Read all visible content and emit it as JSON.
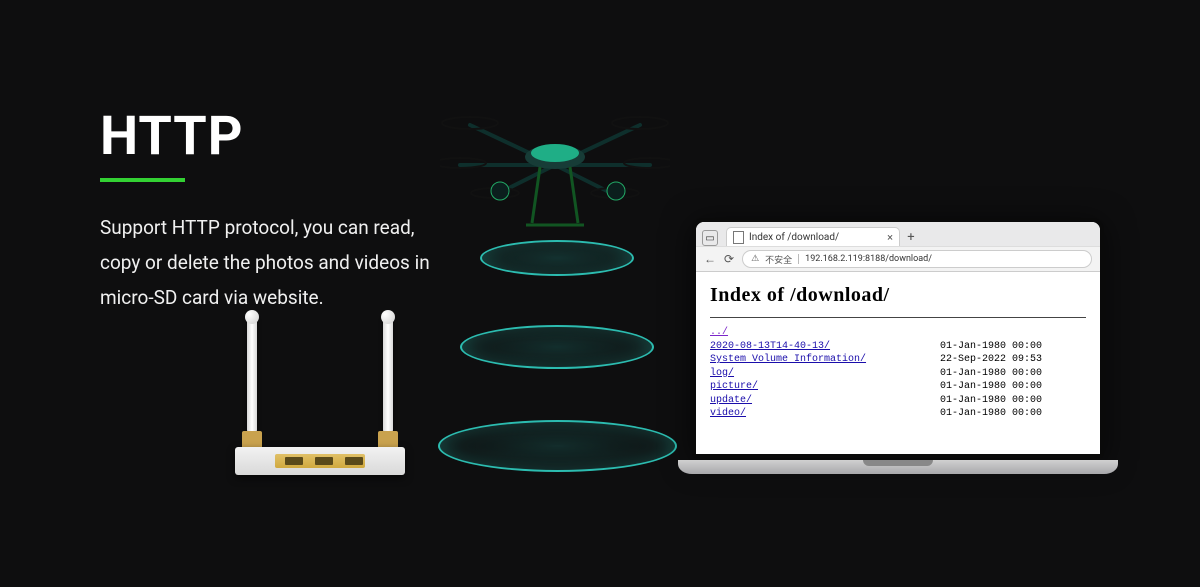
{
  "text": {
    "title": "HTTP",
    "description": "Support HTTP protocol, you can read, copy or delete the photos and videos in micro-SD card via website."
  },
  "browser": {
    "tab_title": "Index of /download/",
    "security_label": "不安全",
    "url": "192.168.2.119:8188/download/"
  },
  "page": {
    "heading": "Index of /download/",
    "parent_link": "../",
    "rows": [
      {
        "name": "2020-08-13T14-40-13/",
        "date": "01-Jan-1980 00:00"
      },
      {
        "name": "System Volume Information/",
        "date": "22-Sep-2022 09:53"
      },
      {
        "name": "log/",
        "date": "01-Jan-1980 00:00"
      },
      {
        "name": "picture/",
        "date": "01-Jan-1980 00:00"
      },
      {
        "name": "update/",
        "date": "01-Jan-1980 00:00"
      },
      {
        "name": "video/",
        "date": "01-Jan-1980 00:00"
      }
    ]
  }
}
